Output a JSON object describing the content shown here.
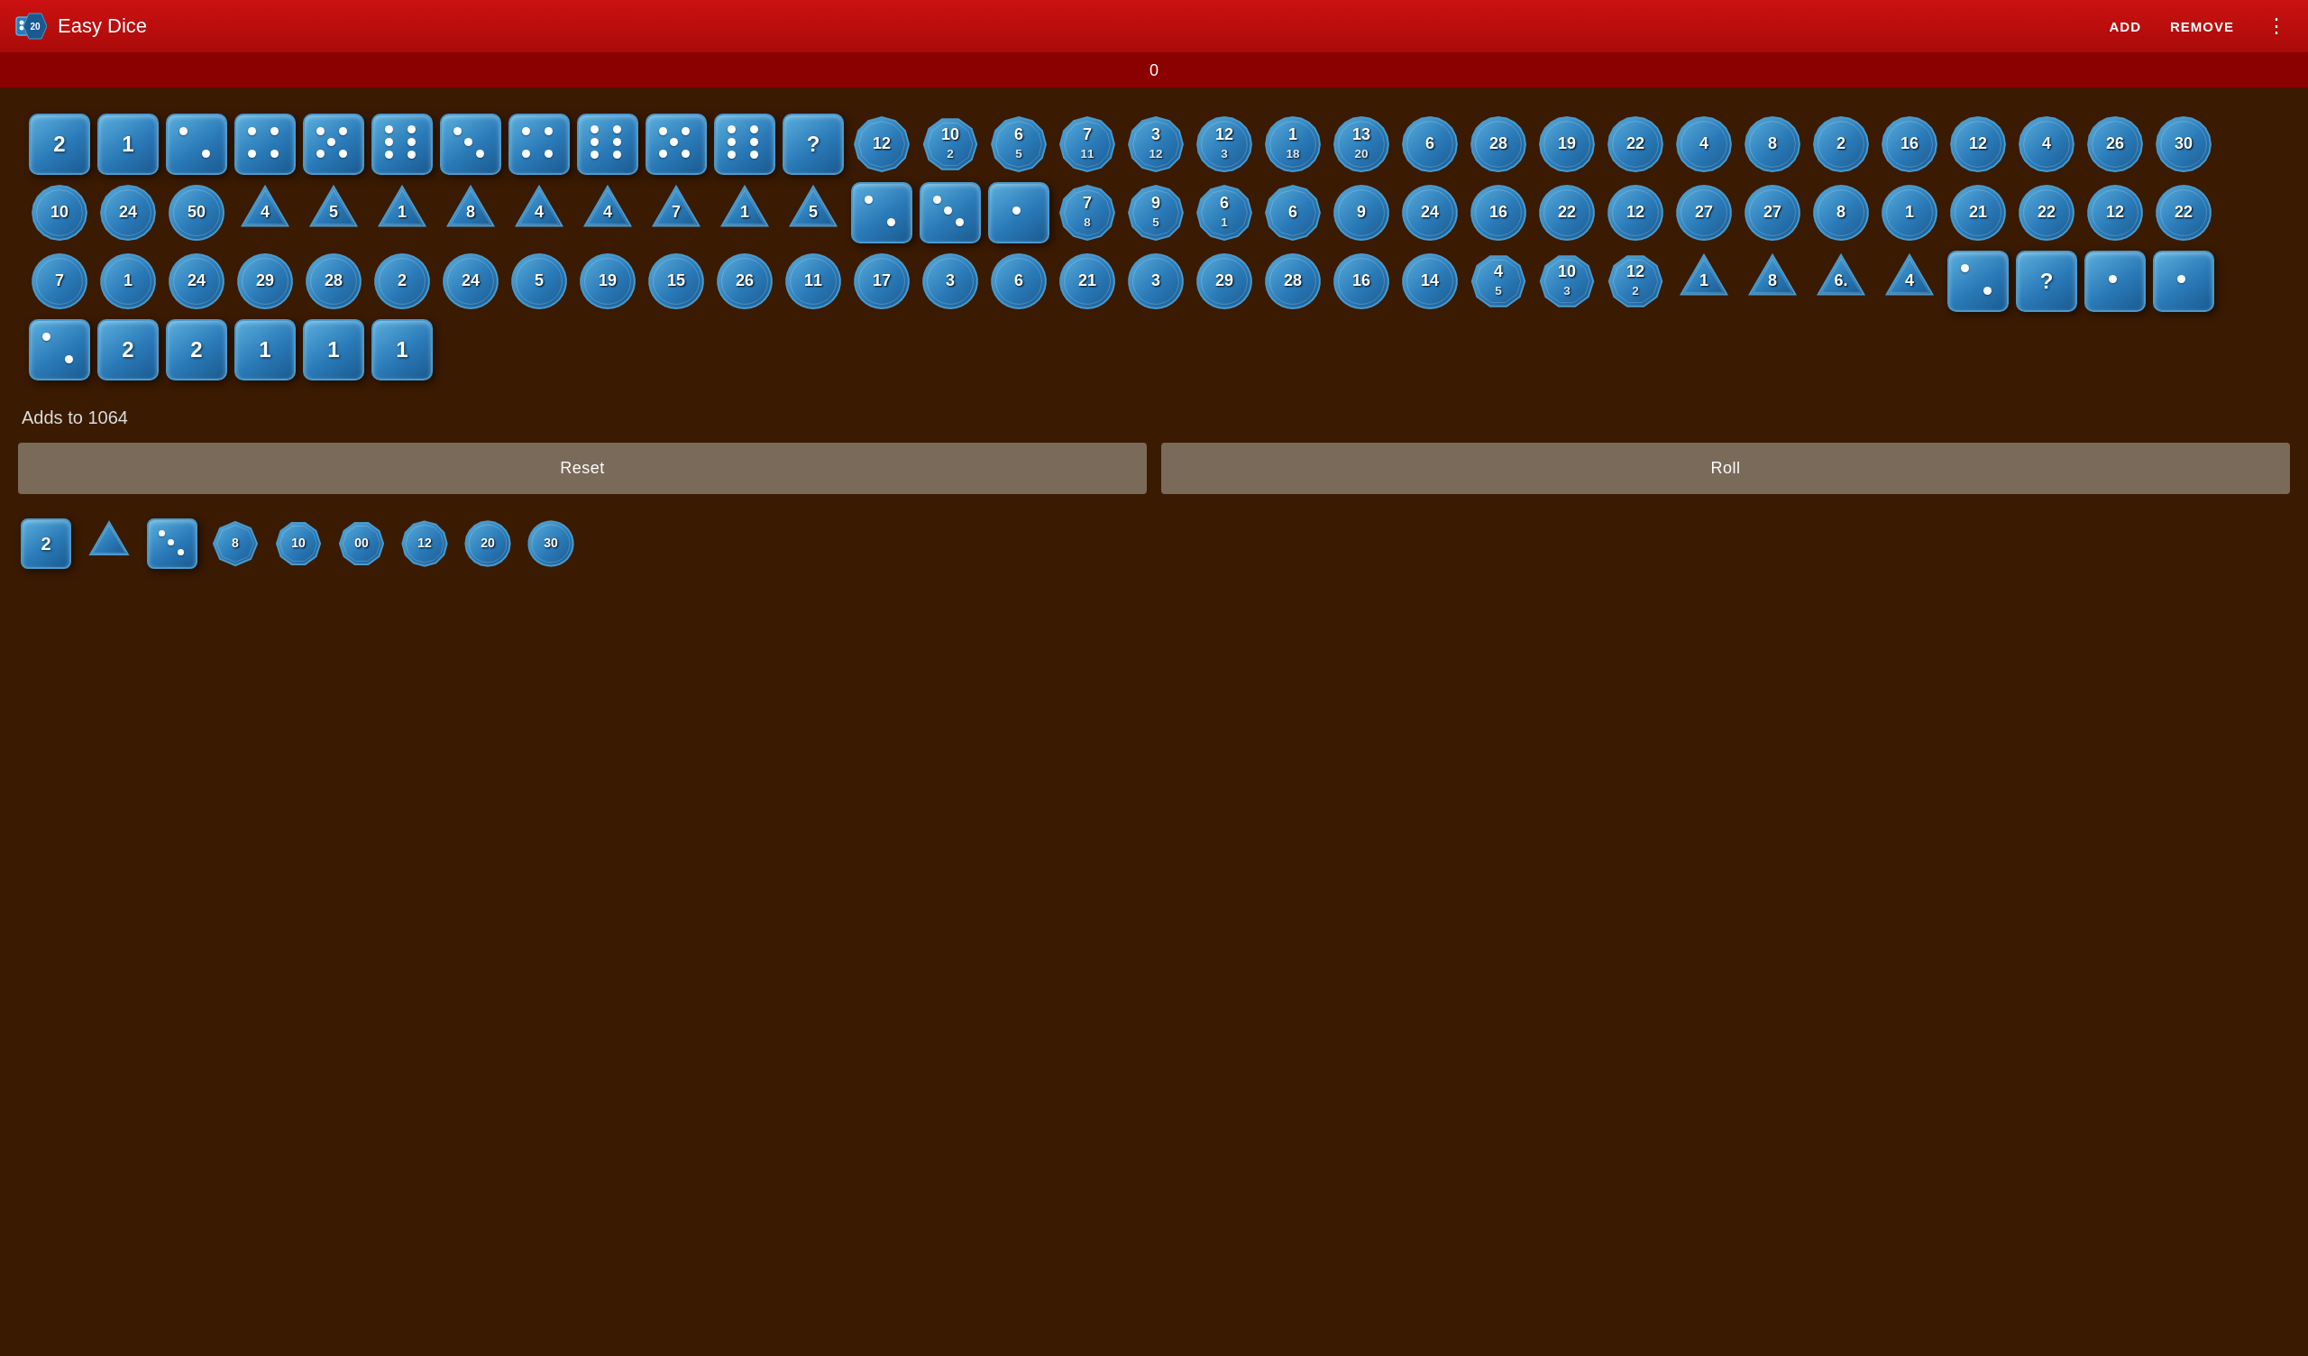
{
  "app": {
    "title": "Easy Dice",
    "icon": "dice-icon"
  },
  "header": {
    "add_label": "ADD",
    "remove_label": "REMOVE",
    "menu_icon": "⋮"
  },
  "score_bar": {
    "value": "0"
  },
  "adds_to": {
    "label": "Adds to 1064"
  },
  "buttons": {
    "reset_label": "Reset",
    "roll_label": "Roll"
  },
  "colors": {
    "bg": "#3a1a00",
    "header": "#cc1111",
    "die_fill_dark": "#1a5a90",
    "die_fill_mid": "#2a7ab8",
    "die_fill_light": "#5aaedc",
    "score_bar": "#8b0000"
  },
  "dice_selector": [
    {
      "type": "d6",
      "label": "2",
      "dots": 0
    },
    {
      "type": "d4",
      "label": "d4"
    },
    {
      "type": "d6dots",
      "label": "d6",
      "dots": 3
    },
    {
      "type": "d8",
      "label": "8"
    },
    {
      "type": "d10",
      "label": "10"
    },
    {
      "type": "d100",
      "label": "00"
    },
    {
      "type": "d12",
      "label": "12"
    },
    {
      "type": "d20",
      "label": "20"
    },
    {
      "type": "d30",
      "label": "30"
    }
  ],
  "dice_rows": [
    {
      "id": "row1",
      "dice": [
        {
          "type": "d6",
          "value": "2"
        },
        {
          "type": "d6",
          "value": "1"
        },
        {
          "type": "d6dots",
          "dots": 2
        },
        {
          "type": "d6dots",
          "dots": 4
        },
        {
          "type": "d6dots",
          "dots": 5
        },
        {
          "type": "d6dots",
          "dots": 6
        },
        {
          "type": "d6dots",
          "dots": 3
        },
        {
          "type": "d6dots",
          "dots": 4
        },
        {
          "type": "d6dots",
          "dots": 6
        },
        {
          "type": "d6dots",
          "dots": 5
        },
        {
          "type": "d6dots",
          "dots": 6
        },
        {
          "type": "d6",
          "value": "?"
        },
        {
          "type": "d12",
          "value": "12",
          "sub": ""
        },
        {
          "type": "d10",
          "value": "10",
          "sub": "2"
        },
        {
          "type": "d12",
          "value": "6",
          "sub": "5"
        },
        {
          "type": "d12",
          "value": "7",
          "sub": "11"
        },
        {
          "type": "d12",
          "value": "3",
          "sub": "12"
        }
      ]
    },
    {
      "id": "row2",
      "dice": [
        {
          "type": "d20",
          "value": "12",
          "sub": "3"
        },
        {
          "type": "d20",
          "value": "1",
          "sub": "18"
        },
        {
          "type": "d20",
          "value": "13",
          "sub": "20"
        },
        {
          "type": "d20",
          "value": "6",
          "sub": ""
        },
        {
          "type": "d20",
          "value": "28",
          "sub": ""
        },
        {
          "type": "d20",
          "value": "19",
          "sub": ""
        },
        {
          "type": "d20",
          "value": "22",
          "sub": ""
        },
        {
          "type": "d20",
          "value": "4",
          "sub": ""
        },
        {
          "type": "d20",
          "value": "8",
          "sub": ""
        },
        {
          "type": "d20",
          "value": "2",
          "sub": ""
        },
        {
          "type": "d20",
          "value": "16",
          "sub": ""
        },
        {
          "type": "d20",
          "value": "12",
          "sub": ""
        },
        {
          "type": "d20",
          "value": "4",
          "sub": ""
        },
        {
          "type": "d20",
          "value": "26",
          "sub": ""
        },
        {
          "type": "d20",
          "value": "30",
          "sub": ""
        },
        {
          "type": "d20",
          "value": "10",
          "sub": ""
        },
        {
          "type": "d20",
          "value": "24",
          "sub": ""
        }
      ]
    },
    {
      "id": "row3",
      "dice": [
        {
          "type": "d50",
          "value": "50"
        },
        {
          "type": "d4",
          "value": "4"
        },
        {
          "type": "d4",
          "value": "5"
        },
        {
          "type": "d4",
          "value": "1"
        },
        {
          "type": "d4",
          "value": "8"
        },
        {
          "type": "d4",
          "value": "4"
        },
        {
          "type": "d4",
          "value": "4"
        },
        {
          "type": "d4",
          "value": "7"
        },
        {
          "type": "d4",
          "value": "1"
        },
        {
          "type": "d4",
          "value": "5"
        },
        {
          "type": "d6dots",
          "dots": 2
        },
        {
          "type": "d6dots",
          "dots": 3
        },
        {
          "type": "d6dots",
          "dots": 1
        },
        {
          "type": "d12",
          "value": "7",
          "sub": "8"
        },
        {
          "type": "d12",
          "value": "9",
          "sub": "5"
        },
        {
          "type": "d12",
          "value": "6",
          "sub": "1"
        },
        {
          "type": "d12",
          "value": "6",
          "sub": ""
        }
      ]
    },
    {
      "id": "row4",
      "dice": [
        {
          "type": "d30",
          "value": "9"
        },
        {
          "type": "d30",
          "value": "24"
        },
        {
          "type": "d30",
          "value": "16"
        },
        {
          "type": "d30",
          "value": "22"
        },
        {
          "type": "d30",
          "value": "12"
        },
        {
          "type": "d30",
          "value": "27"
        },
        {
          "type": "d30",
          "value": "27"
        },
        {
          "type": "d30",
          "value": "8"
        },
        {
          "type": "d30",
          "value": "1"
        },
        {
          "type": "d30",
          "value": "21"
        },
        {
          "type": "d30",
          "value": "22"
        },
        {
          "type": "d30",
          "value": "12"
        },
        {
          "type": "d30",
          "value": "22"
        },
        {
          "type": "d30",
          "value": "7"
        },
        {
          "type": "d30",
          "value": "1"
        },
        {
          "type": "d30",
          "value": "24"
        },
        {
          "type": "d30",
          "value": "29"
        }
      ]
    },
    {
      "id": "row5",
      "dice": [
        {
          "type": "d30",
          "value": "28"
        },
        {
          "type": "d30",
          "value": "2"
        },
        {
          "type": "d30",
          "value": "24"
        },
        {
          "type": "d30",
          "value": "5"
        },
        {
          "type": "d30",
          "value": "19"
        },
        {
          "type": "d30",
          "value": "15"
        },
        {
          "type": "d30",
          "value": "26"
        },
        {
          "type": "d30",
          "value": "11"
        },
        {
          "type": "d30",
          "value": "17"
        },
        {
          "type": "d30",
          "value": "3"
        },
        {
          "type": "d30",
          "value": "6"
        },
        {
          "type": "d30",
          "value": "21"
        },
        {
          "type": "d30",
          "value": "3"
        },
        {
          "type": "d30",
          "value": "29"
        },
        {
          "type": "d30",
          "value": "28"
        },
        {
          "type": "d30",
          "value": "16"
        },
        {
          "type": "d30",
          "value": "14"
        }
      ]
    },
    {
      "id": "row6",
      "dice": [
        {
          "type": "d10",
          "value": "4",
          "sub": "5"
        },
        {
          "type": "d10",
          "value": "10",
          "sub": "3"
        },
        {
          "type": "d10",
          "value": "12",
          "sub": "2"
        },
        {
          "type": "d4",
          "value": "1"
        },
        {
          "type": "d4",
          "value": "8"
        },
        {
          "type": "d4",
          "value": "6."
        },
        {
          "type": "d4",
          "value": "4"
        },
        {
          "type": "d6dots",
          "dots": 2
        },
        {
          "type": "d6",
          "value": "?"
        },
        {
          "type": "d6dots",
          "dots": 1
        },
        {
          "type": "d6dots",
          "dots": 1
        },
        {
          "type": "d6dots",
          "dots": 2
        },
        {
          "type": "d6",
          "value": "2"
        },
        {
          "type": "d6",
          "value": "2"
        },
        {
          "type": "d6",
          "value": "1"
        },
        {
          "type": "d6",
          "value": "1"
        },
        {
          "type": "d6",
          "value": "1"
        }
      ]
    }
  ]
}
